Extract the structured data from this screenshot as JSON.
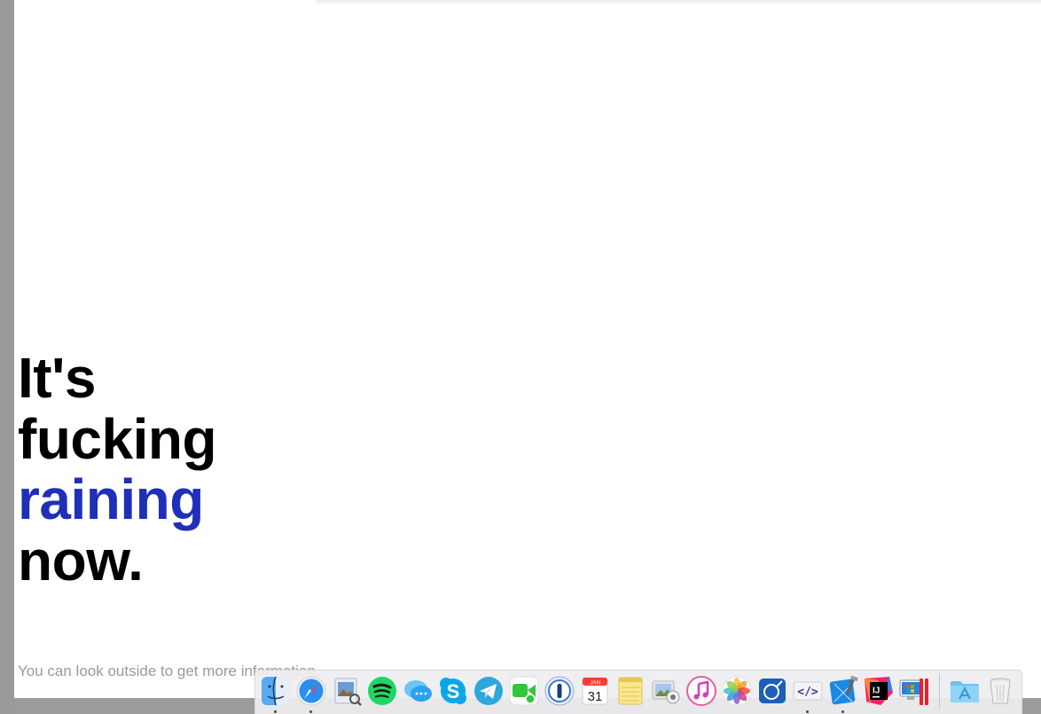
{
  "headline": {
    "line1": "It's",
    "line2": "fucking",
    "line3": "raining",
    "line4": "now."
  },
  "subtext": "You can look outside to get more information.",
  "colors": {
    "accent": "#1f2fb8",
    "text": "#000000",
    "subtext": "#999999",
    "background": "#ffffff"
  },
  "dock": {
    "apps": [
      {
        "icon": "finder-icon",
        "running": true
      },
      {
        "icon": "safari-icon",
        "running": true
      },
      {
        "icon": "preview-icon",
        "running": false
      },
      {
        "icon": "spotify-icon",
        "running": false
      },
      {
        "icon": "messages-icon",
        "running": false
      },
      {
        "icon": "skype-icon",
        "running": false
      },
      {
        "icon": "telegram-icon",
        "running": false
      },
      {
        "icon": "facetime-icon",
        "running": false
      },
      {
        "icon": "1password-icon",
        "running": false
      },
      {
        "icon": "calendar-icon",
        "running": false
      },
      {
        "icon": "notes-icon",
        "running": false
      },
      {
        "icon": "preview-slideshow-icon",
        "running": false
      },
      {
        "icon": "itunes-icon",
        "running": false
      },
      {
        "icon": "photos-icon",
        "running": false
      },
      {
        "icon": "instruments-icon",
        "running": false
      },
      {
        "icon": "code-editor-icon",
        "running": true
      },
      {
        "icon": "xcode-icon",
        "running": true
      },
      {
        "icon": "intellij-icon",
        "running": false
      },
      {
        "icon": "parallels-icon",
        "running": false
      }
    ],
    "calendar": {
      "month": "JAN",
      "day": "31"
    },
    "intellij_label": "IJ",
    "folders": [
      {
        "icon": "applications-folder-icon"
      },
      {
        "icon": "trash-icon"
      }
    ]
  }
}
